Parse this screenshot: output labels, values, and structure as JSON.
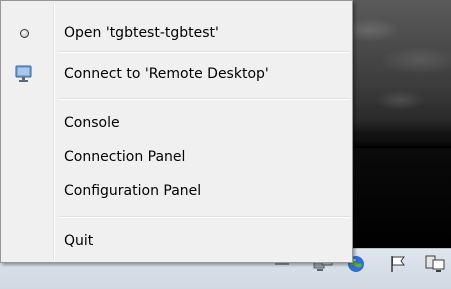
{
  "menu": {
    "items": [
      {
        "label": "Open 'tgbtest-tgbtest'",
        "icon": "radio-bullet-icon"
      },
      {
        "label": "Connect to 'Remote Desktop'",
        "icon": "monitor-icon"
      },
      {
        "label": "Console",
        "icon": ""
      },
      {
        "label": "Connection Panel",
        "icon": ""
      },
      {
        "label": "Configuration Panel",
        "icon": ""
      },
      {
        "label": "Quit",
        "icon": ""
      }
    ]
  },
  "tray": {
    "icons": [
      "tray-app-icon",
      "network-icon",
      "globe-icon",
      "flag-icon",
      "computer-icon"
    ]
  },
  "colors": {
    "menu_background": "#f0f0f0",
    "menu_border": "#979797",
    "taskbar": "#dfe6ee",
    "wallpaper_dark": "#000000"
  }
}
